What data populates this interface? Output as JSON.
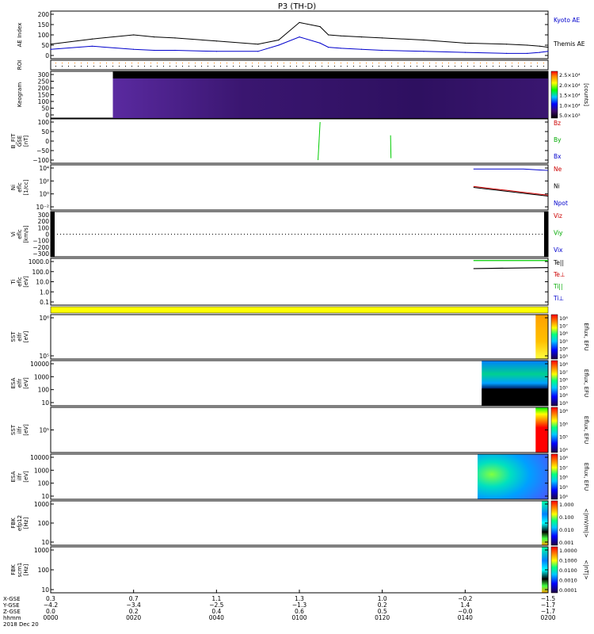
{
  "title": "P3 (TH-D)",
  "colors": {
    "kyoto": "#0000cc",
    "themis": "#000000",
    "bz": "#cc0000",
    "by": "#00aa00",
    "bx": "#0000cc",
    "vertical_line": "#00cc00",
    "density_e": "#cc0000",
    "density_i": "#000000",
    "density_pot": "#0000cc",
    "temp_e": "#00cc00",
    "temp_i": "#000000",
    "mode_bar": "#ffff00"
  },
  "chart_data": [
    {
      "type": "line",
      "panel": "ae_index",
      "ylabel": "AE Index",
      "yticks": [
        "200",
        "150",
        "100",
        "50",
        "0"
      ],
      "ylim": [
        0,
        200
      ],
      "x_minutes": [
        0,
        10,
        20,
        25,
        30,
        40,
        50,
        55,
        60,
        65,
        67,
        70,
        75,
        80,
        90,
        100,
        110,
        115,
        118,
        120
      ],
      "series": [
        {
          "name": "Themis AE",
          "values": [
            55,
            80,
            100,
            90,
            85,
            70,
            55,
            75,
            160,
            140,
            100,
            95,
            90,
            85,
            75,
            60,
            55,
            50,
            45,
            40
          ]
        },
        {
          "name": "Kyoto AE",
          "values": [
            30,
            45,
            30,
            25,
            25,
            20,
            20,
            50,
            90,
            60,
            40,
            35,
            30,
            25,
            20,
            15,
            10,
            10,
            15,
            20
          ]
        }
      ]
    },
    {
      "type": "heatmap",
      "panel": "roi",
      "ylabel": "ROI"
    },
    {
      "type": "heatmap",
      "panel": "keogram",
      "ylabel": "Keogram",
      "yticks": [
        "300",
        "250",
        "200",
        "150",
        "100",
        "50",
        "0"
      ],
      "ylim": [
        0,
        300
      ],
      "data_start_min": 15,
      "colorbar_label": "[counts]",
      "colorbar_ticks": [
        "2.5×10⁴",
        "2.0×10⁴",
        "1.5×10⁴",
        "1.0×10⁴",
        "5.0×10³"
      ]
    },
    {
      "type": "line",
      "panel": "b_fit",
      "ylabel_lines": [
        "B_FIT",
        "GSE",
        "[nT]"
      ],
      "yticks": [
        "100",
        "50",
        "0",
        "−50",
        "−100"
      ],
      "ylim": [
        -100,
        100
      ],
      "legend": [
        "Bz",
        "By",
        "Bx"
      ],
      "segments": [
        {
          "x": [
            64.5,
            65.0
          ],
          "y": [
            -100,
            100
          ]
        },
        {
          "x": [
            82.0,
            82.1
          ],
          "y": [
            30,
            -90
          ]
        }
      ]
    },
    {
      "type": "line",
      "panel": "density",
      "ylabel_lines": [
        "Ni",
        "eflc",
        "[1/cc]"
      ],
      "yticks": [
        "10⁴",
        "10²",
        "10⁰",
        "10⁻²"
      ],
      "ylim_log": [
        -3,
        5
      ],
      "legend": [
        "Ne",
        "Ni",
        "Npot"
      ],
      "x_minutes": [
        102,
        104,
        106,
        108,
        110,
        112,
        114,
        116,
        118,
        120
      ],
      "series": [
        {
          "name": "Ne",
          "values": [
            1.2,
            1.0,
            0.8,
            0.6,
            0.4,
            0.2,
            0.0,
            -0.2,
            -0.4,
            -0.6
          ]
        },
        {
          "name": "Ni",
          "values": [
            1.0,
            0.8,
            0.6,
            0.4,
            0.2,
            0.0,
            -0.2,
            -0.4,
            -0.6,
            -0.8
          ]
        },
        {
          "name": "Npot",
          "values": [
            4.8,
            4.8,
            4.8,
            4.8,
            4.8,
            4.8,
            4.8,
            4.7,
            4.6,
            4.5
          ]
        }
      ]
    },
    {
      "type": "line",
      "panel": "velocity",
      "ylabel_lines": [
        "Vi",
        "eflc",
        "[km/s]"
      ],
      "yticks": [
        "300",
        "200",
        "100",
        "0",
        "−100",
        "−200",
        "−300"
      ],
      "ylim": [
        -300,
        300
      ],
      "legend": [
        "Viz",
        "Viy",
        "Vix"
      ]
    },
    {
      "type": "line",
      "panel": "temperature",
      "ylabel_lines": [
        "Ti",
        "eflc",
        "[eV]"
      ],
      "yticks": [
        "1000.0",
        "100.0",
        "10.0",
        "1.0",
        "0.1"
      ],
      "ylim_log": [
        -1,
        3
      ],
      "legend": [
        "Te||",
        "Te⊥",
        "Ti||",
        "Ti⊥"
      ],
      "x_minutes": [
        102,
        120
      ],
      "series": [
        {
          "name": "Te||",
          "values": [
            3.1,
            3.1
          ]
        },
        {
          "name": "Ti||",
          "values": [
            2.3,
            2.4
          ]
        }
      ]
    },
    {
      "type": "heatmap",
      "panel": "sst_e",
      "ylabel_lines": [
        "SST",
        "elfr",
        "[eV]"
      ],
      "yticks": [
        "10⁶",
        "10⁵"
      ],
      "colorbar_label": "Eflux, EFU",
      "colorbar_ticks": [
        "10⁸",
        "10⁷",
        "10⁶",
        "10⁵",
        "10⁴",
        "10³"
      ],
      "data_start_min": 117
    },
    {
      "type": "heatmap",
      "panel": "esa_e",
      "ylabel_lines": [
        "ESA",
        "elfr",
        "[eV]"
      ],
      "yticks": [
        "10000",
        "1000",
        "100",
        "10"
      ],
      "colorbar_label": "Eflux, EFU",
      "colorbar_ticks": [
        "10⁸",
        "10⁷",
        "10⁶",
        "10⁵",
        "10⁴",
        "10³"
      ],
      "data_start_min": 104
    },
    {
      "type": "heatmap",
      "panel": "sst_i",
      "ylabel_lines": [
        "SST",
        "ilfr",
        "[eV]"
      ],
      "yticks": [
        "10⁵"
      ],
      "colorbar_label": "Eflux, EFU",
      "colorbar_ticks": [
        "10⁸",
        "10⁶",
        "10⁵",
        "10⁴"
      ],
      "data_start_min": 117
    },
    {
      "type": "heatmap",
      "panel": "esa_i",
      "ylabel_lines": [
        "ESA",
        "ilfr",
        "[eV]"
      ],
      "yticks": [
        "10000",
        "1000",
        "100",
        "10"
      ],
      "colorbar_label": "Eflux, EFU",
      "colorbar_ticks": [
        "10⁸",
        "10⁷",
        "10⁶",
        "10⁵",
        "10⁴"
      ],
      "data_start_min": 103
    },
    {
      "type": "heatmap",
      "panel": "fbk_e",
      "ylabel_lines": [
        "FBK",
        "efp12",
        "[Hz]"
      ],
      "yticks": [
        "1000",
        "100",
        "10"
      ],
      "colorbar_label": "<|mV/m|>",
      "colorbar_ticks": [
        "1.000",
        "0.100",
        "0.010",
        "0.001"
      ],
      "data_start_min": 118.5
    },
    {
      "type": "heatmap",
      "panel": "fbk_b",
      "ylabel_lines": [
        "FBK",
        "scm1",
        "[Hz]"
      ],
      "yticks": [
        "1000",
        "100",
        "10"
      ],
      "colorbar_label": "<|nT|>",
      "colorbar_ticks": [
        "1.0000",
        "0.1000",
        "0.0100",
        "0.0010",
        "0.0001"
      ],
      "data_start_min": 118.5
    }
  ],
  "legends": {
    "ae": [
      "Kyoto AE",
      "Themis AE"
    ]
  },
  "x_axis": {
    "row_labels": [
      "X-GSE",
      "Y-GSE",
      "Z-GSE",
      "hhmm",
      "2018 Dec 20"
    ],
    "ticks": [
      {
        "minute": 0,
        "vals": [
          "0.3",
          "−4.2",
          "0.0",
          "0000"
        ]
      },
      {
        "minute": 20,
        "vals": [
          "0.7",
          "−3.4",
          "0.2",
          "0020"
        ]
      },
      {
        "minute": 40,
        "vals": [
          "1.1",
          "−2.5",
          "0.4",
          "0040"
        ]
      },
      {
        "minute": 60,
        "vals": [
          "1.3",
          "−1.3",
          "0.6",
          "0100"
        ]
      },
      {
        "minute": 80,
        "vals": [
          "1.0",
          "0.2",
          "0.5",
          "0120"
        ]
      },
      {
        "minute": 100,
        "vals": [
          "−0.2",
          "1.4",
          "−0.0",
          "0140"
        ]
      },
      {
        "minute": 120,
        "vals": [
          "−1.5",
          "−1.7",
          "−1.7",
          "0200"
        ]
      }
    ]
  }
}
